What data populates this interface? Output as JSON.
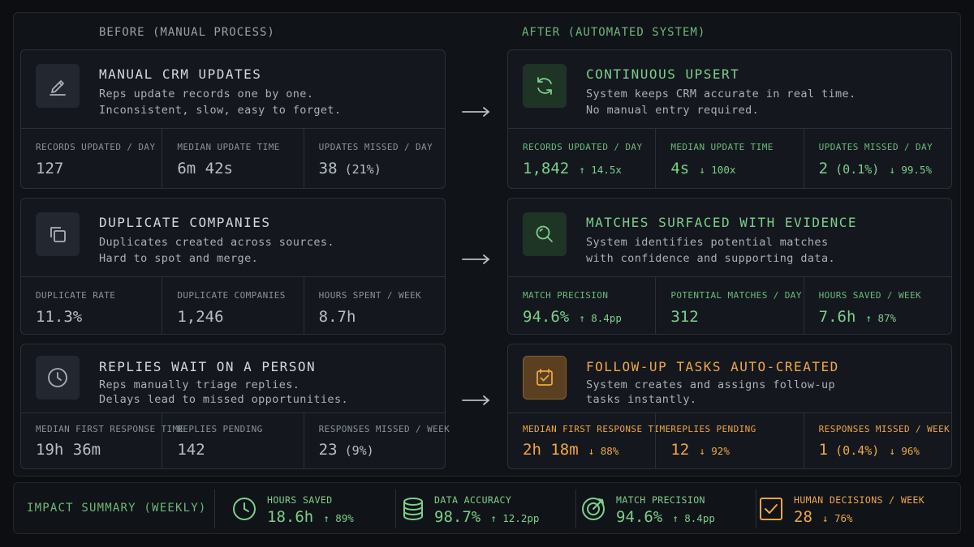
{
  "headers": {
    "before": "BEFORE (MANUAL PROCESS)",
    "after": "AFTER (AUTOMATED SYSTEM)"
  },
  "before": [
    {
      "icon": "pencil-icon",
      "title": "MANUAL CRM UPDATES",
      "desc": "Reps update records one by one.\nInconsistent, slow, easy to forget.",
      "metrics": [
        {
          "label": "RECORDS UPDATED / DAY",
          "value": "127"
        },
        {
          "label": "MEDIAN UPDATE TIME",
          "value": "6m 42s"
        },
        {
          "label": "UPDATES MISSED / DAY",
          "value": "38",
          "sub": " (21%)"
        }
      ]
    },
    {
      "icon": "duplicate-icon",
      "title": "DUPLICATE COMPANIES",
      "desc": "Duplicates created across sources.\nHard to spot and merge.",
      "metrics": [
        {
          "label": "DUPLICATE RATE",
          "value": "11.3%"
        },
        {
          "label": "DUPLICATE COMPANIES",
          "value": "1,246"
        },
        {
          "label": "HOURS SPENT / WEEK",
          "value": "8.7h"
        }
      ]
    },
    {
      "icon": "clock-icon",
      "title": "REPLIES WAIT ON A PERSON",
      "desc": "Reps manually triage replies.\nDelays lead to missed opportunities.",
      "metrics": [
        {
          "label": "MEDIAN FIRST RESPONSE TIME",
          "value": "19h 36m"
        },
        {
          "label": "REPLIES PENDING",
          "value": "142"
        },
        {
          "label": "RESPONSES MISSED / WEEK",
          "value": "23",
          "sub": " (9%)"
        }
      ]
    }
  ],
  "after": [
    {
      "icon": "sync-icon",
      "title": "CONTINUOUS UPSERT",
      "desc": "System keeps CRM accurate in real time.\nNo manual entry required.",
      "metrics": [
        {
          "label": "RECORDS UPDATED / DAY",
          "value": "1,842",
          "delta": "↑ 14.5x"
        },
        {
          "label": "MEDIAN UPDATE TIME",
          "value": "4s",
          "delta": "↓ 100x"
        },
        {
          "label": "UPDATES MISSED / DAY",
          "value": "2",
          "sub": " (0.1%)",
          "delta": "↓ 99.5%"
        }
      ]
    },
    {
      "icon": "magnifier-icon",
      "title": "MATCHES SURFACED WITH EVIDENCE",
      "desc": "System identifies potential matches\nwith confidence and supporting data.",
      "metrics": [
        {
          "label": "MATCH PRECISION",
          "value": "94.6%",
          "delta": "↑ 8.4pp"
        },
        {
          "label": "POTENTIAL MATCHES / DAY",
          "value": "312"
        },
        {
          "label": "HOURS SAVED / WEEK",
          "value": "7.6h",
          "delta": "↑ 87%"
        }
      ]
    },
    {
      "icon": "task-check-icon",
      "title": "FOLLOW-UP TASKS AUTO-CREATED",
      "desc": "System creates and assigns follow-up\ntasks instantly.",
      "metrics": [
        {
          "label": "MEDIAN FIRST RESPONSE TIME",
          "value": "2h 18m",
          "delta": "↓ 88%"
        },
        {
          "label": "REPLIES PENDING",
          "value": "12",
          "delta": "↓ 92%"
        },
        {
          "label": "RESPONSES MISSED / WEEK",
          "value": "1",
          "sub": " (0.4%)",
          "delta": "↓ 96%"
        }
      ]
    }
  ],
  "summary": {
    "title": "IMPACT SUMMARY (WEEKLY)",
    "items": [
      {
        "icon": "clock-icon",
        "label": "HOURS SAVED",
        "value": "18.6h",
        "delta": "↑ 89%"
      },
      {
        "icon": "database-icon",
        "label": "DATA ACCURACY",
        "value": "98.7%",
        "delta": "↑ 12.2pp"
      },
      {
        "icon": "target-icon",
        "label": "MATCH PRECISION",
        "value": "94.6%",
        "delta": "↑ 8.4pp"
      },
      {
        "icon": "checkbox-icon",
        "label": "HUMAN DECISIONS / WEEK",
        "value": "28",
        "delta": "↓ 76%"
      }
    ]
  },
  "colors": {
    "green": "#7ccf8a",
    "orange": "#f0a645",
    "background": "#0c0e11",
    "card": "#14181e"
  }
}
